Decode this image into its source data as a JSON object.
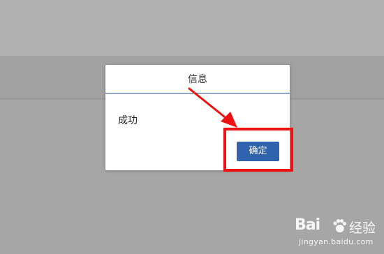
{
  "dialog": {
    "title": "信息",
    "message": "成功",
    "ok_label": "确定"
  },
  "watermark": {
    "brand": "Bai",
    "brand_cn": "经验",
    "url": "jingyan.baidu.com"
  },
  "colors": {
    "button": "#2f63ad",
    "annotation": "#ee1111",
    "header_rule": "#2e5a96"
  }
}
